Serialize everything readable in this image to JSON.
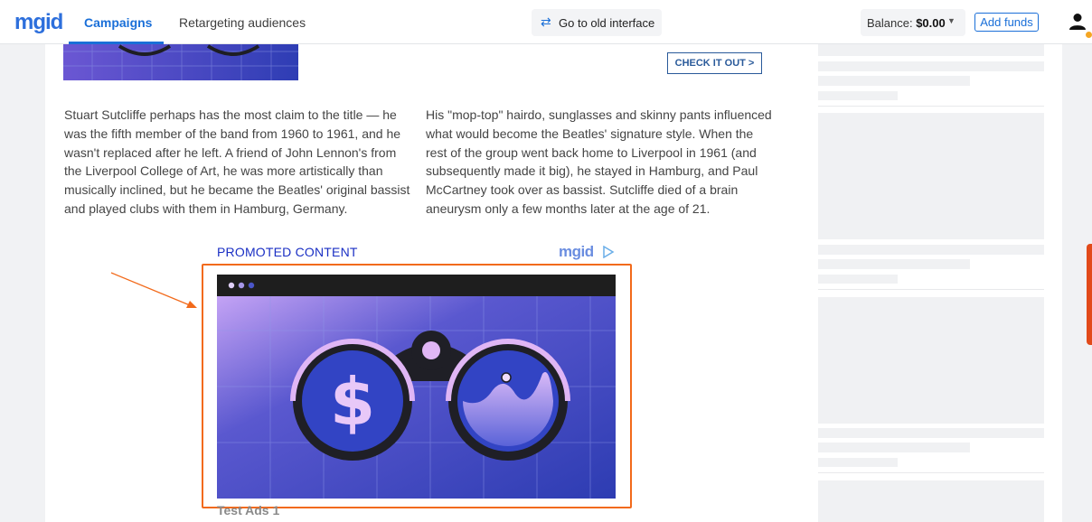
{
  "header": {
    "logo": "mgid",
    "tabs": [
      {
        "label": "Campaigns",
        "active": true
      },
      {
        "label": "Retargeting audiences",
        "active": false
      }
    ],
    "old_interface_label": "Go to old interface",
    "balance_label": "Balance: ",
    "balance_amount": "$0.00",
    "add_funds_label": "Add funds"
  },
  "article": {
    "cta_label": "CHECK IT OUT >",
    "paragraph_left": "Stuart Sutcliffe perhaps has the most claim to the title — he was the fifth member of the band from 1960 to 1961, and he wasn't replaced after he left. A friend of John Lennon's from the Liverpool College of Art, he was more artistically than musically inclined, but he became the Beatles' original bassist and played clubs with them in Hamburg, Germany.",
    "paragraph_right": "His \"mop-top\" hairdo, sunglasses and skinny pants influenced what would become the Beatles' signature style. When the rest of the group went back home to Liverpool in 1961 (and subsequently made it big), he stayed in Hamburg, and Paul McCartney took over as bassist. Sutcliffe died of a brain aneurysm only a few months later at the age of 21."
  },
  "widget": {
    "promoted_label": "PROMOTED CONTENT",
    "brand_label": "mgid",
    "ad_title": "Test Ads 1",
    "ad_image_symbol": "$"
  },
  "colors": {
    "accent": "#1a6fd8",
    "highlight_frame": "#f26a1b",
    "ad_background": "#3a48c0"
  }
}
